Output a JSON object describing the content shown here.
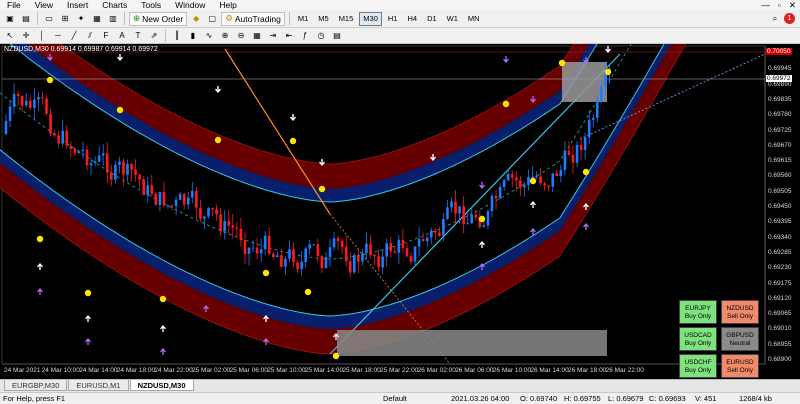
{
  "menu": {
    "items": [
      "File",
      "View",
      "Insert",
      "Charts",
      "Tools",
      "Window",
      "Help"
    ],
    "window_controls": [
      "—",
      "▫",
      "✕"
    ]
  },
  "toolbar": {
    "new_order": "New Order",
    "auto_trading": "AutoTrading",
    "timeframes": [
      "M1",
      "M5",
      "M15",
      "M30",
      "H1",
      "H4",
      "D1",
      "W1",
      "MN"
    ],
    "active_timeframe": "M30",
    "notification_badge": "1"
  },
  "chart": {
    "title": "NZDUSD,M30  0.69914 0.69987 0.69914 0.69972",
    "current_price": "0.69972",
    "top_price": "0.70050",
    "price_axis": [
      "0.70000",
      "0.69945",
      "0.69890",
      "0.69835",
      "0.69780",
      "0.69725",
      "0.69670",
      "0.69615",
      "0.69560",
      "0.69505",
      "0.69450",
      "0.69395",
      "0.69340",
      "0.69285",
      "0.69230",
      "0.69175",
      "0.69120",
      "0.69065",
      "0.69010",
      "0.68955",
      "0.68900"
    ],
    "time_axis": [
      "24 Mar 2021",
      "24 Mar 10:00",
      "24 Mar 14:00",
      "24 Mar 18:00",
      "24 Mar 22:00",
      "25 Mar 02:00",
      "25 Mar 06:00",
      "25 Mar 10:00",
      "25 Mar 14:00",
      "25 Mar 18:00",
      "25 Mar 22:00",
      "26 Mar 02:00",
      "26 Mar 06:00",
      "26 Mar 10:00",
      "26 Mar 14:00",
      "26 Mar 18:00",
      "26 Mar 22:00"
    ],
    "colors": {
      "bull": "#1e7bff",
      "bear": "#ff1a1a",
      "outer_band": "#6b0000",
      "inner_band": "#0a1f6b",
      "band_line": "#33c7e6",
      "dot": "#ffe600",
      "arrow_white": "#ffffff",
      "arrow_purple": "#b36bff"
    }
  },
  "currency_panel": [
    {
      "pair": "EURJPY",
      "signal": "Buy Only",
      "color": "#7ee37e"
    },
    {
      "pair": "NZDUSD",
      "signal": "Sell Only",
      "color": "#f08a6a"
    },
    {
      "pair": "USDCAD",
      "signal": "Buy Only",
      "color": "#7ee37e"
    },
    {
      "pair": "GBPUSD",
      "signal": "Neutral",
      "color": "#8a8a8a"
    },
    {
      "pair": "USDCHF",
      "signal": "Buy Only",
      "color": "#7ee37e"
    },
    {
      "pair": "EURUSD",
      "signal": "Sell Only",
      "color": "#f08a6a"
    },
    {
      "pair": "AUDUSD",
      "signal": "Sell Only",
      "color": "#f08a6a"
    },
    {
      "pair": "USDJPY",
      "signal": "Buy Only",
      "color": "#7ee37e"
    }
  ],
  "tabs": [
    {
      "label": "EURGBP,M30",
      "active": false
    },
    {
      "label": "EURUSD,M1",
      "active": false
    },
    {
      "label": "NZDUSD,M30",
      "active": true
    }
  ],
  "status": {
    "help": "For Help, press F1",
    "profile": "Default",
    "datetime": "2021.03.26 04:00",
    "open": "O: 0.69740",
    "high": "H: 0.69755",
    "low": "L: 0.69679",
    "close": "C: 0.69693",
    "volume": "V: 451",
    "traffic": "1268/4 kb"
  }
}
